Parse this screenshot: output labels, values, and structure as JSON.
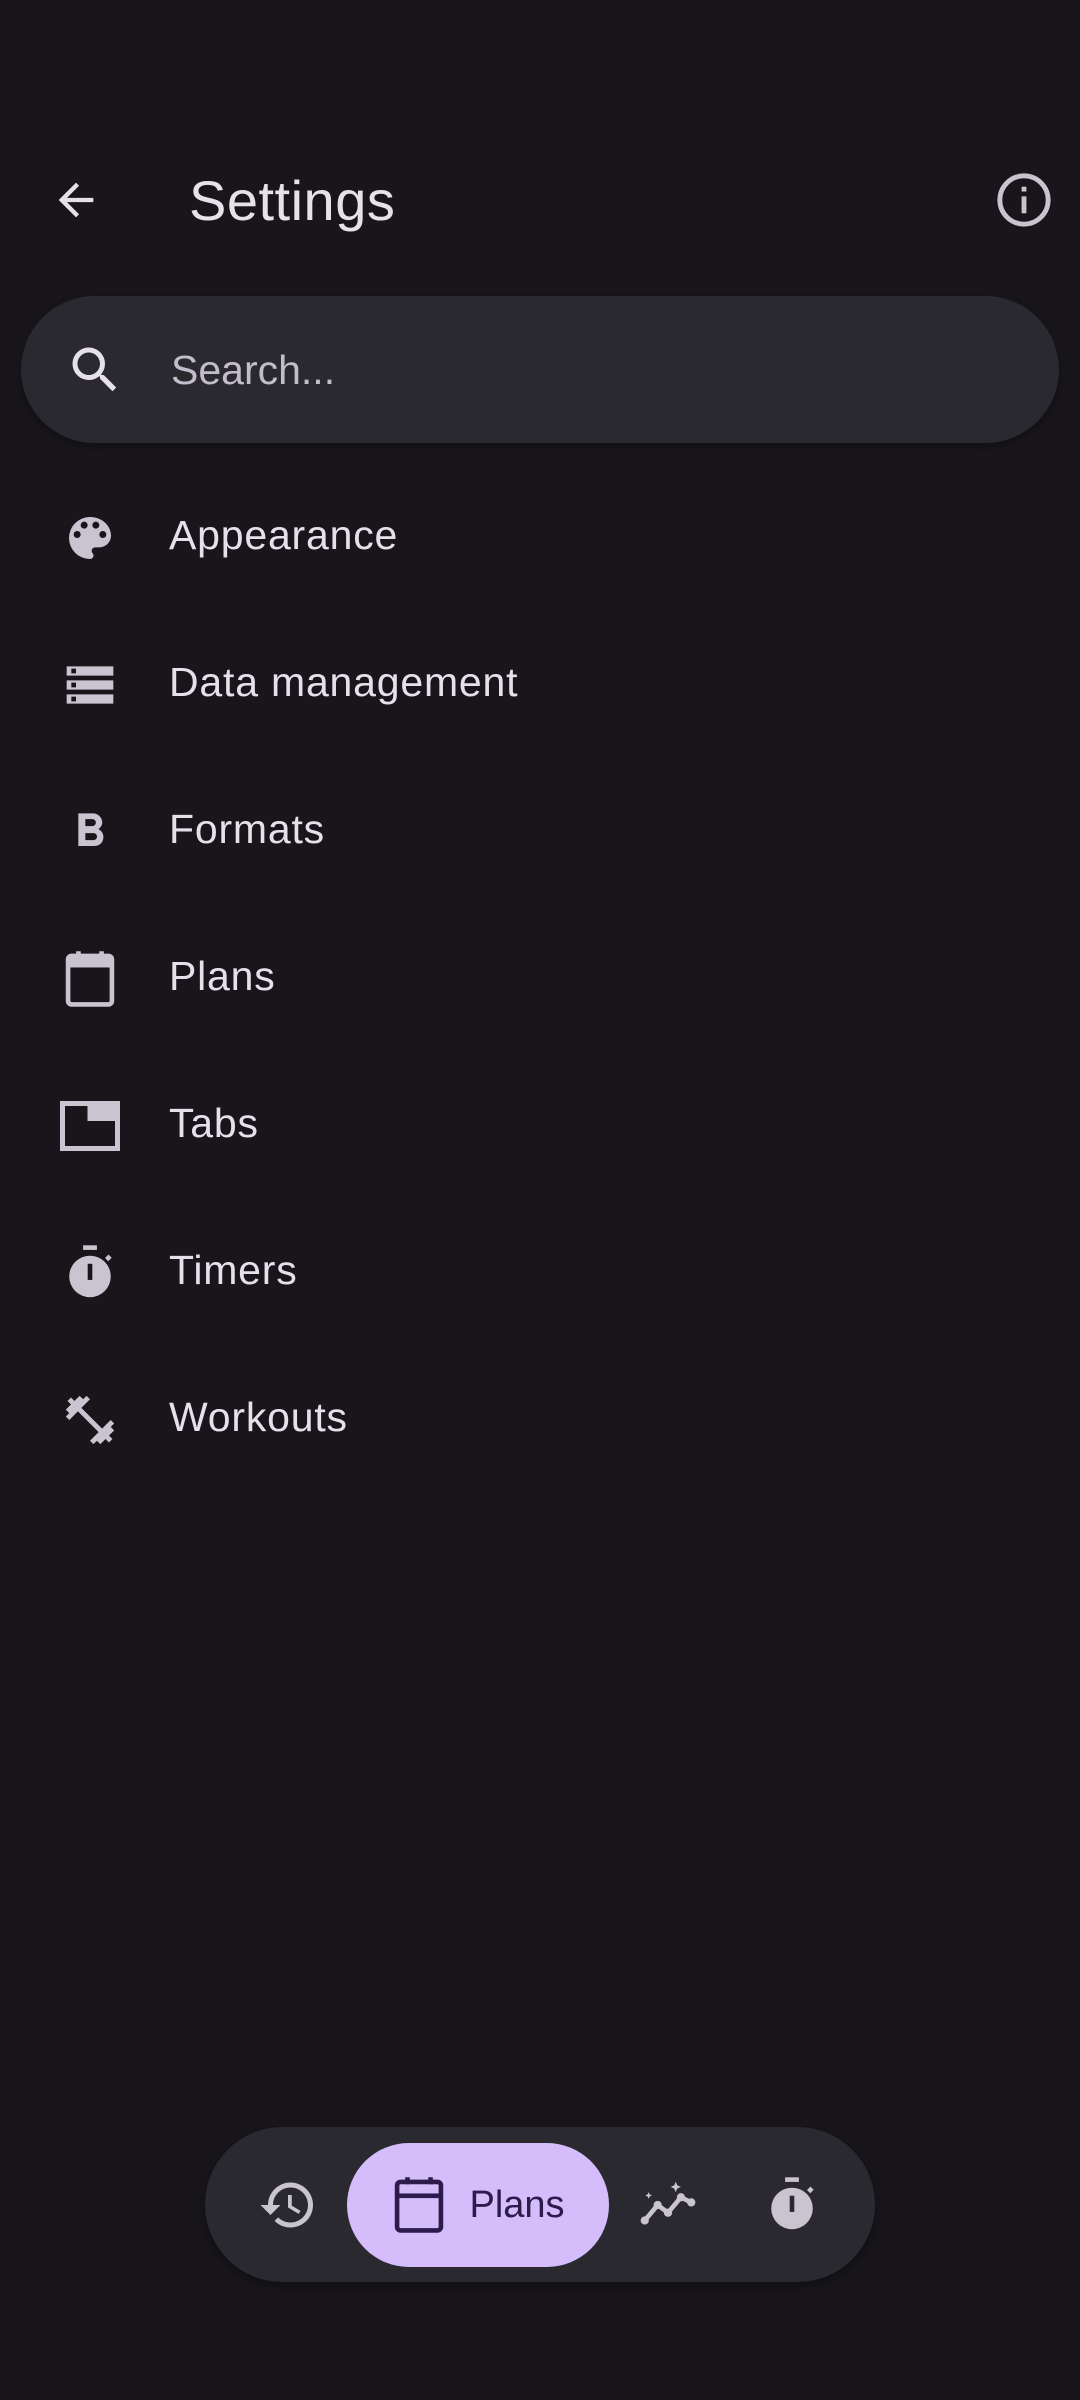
{
  "appbar": {
    "title": "Settings",
    "back_icon": "arrow-back-icon",
    "info_icon": "info-outline-icon"
  },
  "search": {
    "placeholder": "Search...",
    "value": ""
  },
  "settings_items": [
    {
      "label": "Appearance",
      "icon": "palette-icon"
    },
    {
      "label": "Data management",
      "icon": "storage-icon"
    },
    {
      "label": "Formats",
      "icon": "bold-b-icon"
    },
    {
      "label": "Plans",
      "icon": "calendar-icon"
    },
    {
      "label": "Tabs",
      "icon": "tab-icon"
    },
    {
      "label": "Timers",
      "icon": "timer-icon"
    },
    {
      "label": "Workouts",
      "icon": "dumbbell-icon"
    }
  ],
  "bottom_nav": {
    "items": [
      {
        "icon": "history-icon",
        "label": "",
        "selected": false
      },
      {
        "icon": "calendar-icon",
        "label": "Plans",
        "selected": true
      },
      {
        "icon": "insights-graph-icon",
        "label": "",
        "selected": false
      },
      {
        "icon": "timer-icon",
        "label": "",
        "selected": false
      }
    ]
  },
  "colors": {
    "background": "#18161b",
    "surface": "#2b2930",
    "on_surface": "#e7e0ea",
    "icon": "#cac4d0",
    "accent_container": "#d5bdfc",
    "on_accent_container": "#2d1b4b"
  }
}
